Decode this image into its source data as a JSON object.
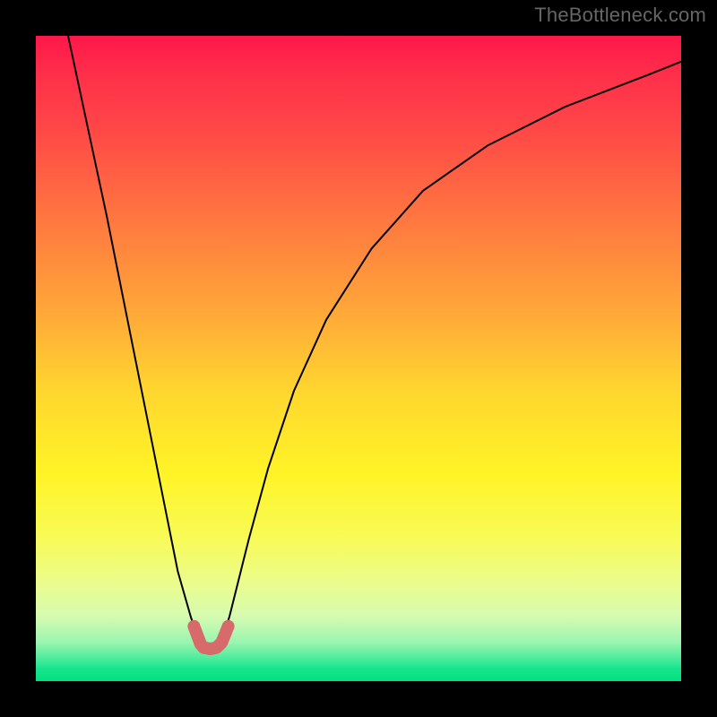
{
  "watermark": "TheBottleneck.com",
  "chart_data": {
    "type": "line",
    "title": "",
    "xlabel": "",
    "ylabel": "",
    "xlim": [
      0,
      100
    ],
    "ylim": [
      0,
      100
    ],
    "series": [
      {
        "name": "bottleneck-curve",
        "x": [
          5,
          8,
          11,
          14,
          17,
          20,
          22,
          24,
          25,
          26,
          27,
          28,
          29,
          30,
          31,
          33,
          36,
          40,
          45,
          52,
          60,
          70,
          82,
          95,
          100
        ],
        "values": [
          100,
          86,
          72,
          57,
          42,
          27,
          17,
          10,
          7,
          5.5,
          5,
          5.5,
          7,
          10,
          14,
          22,
          33,
          45,
          56,
          67,
          76,
          83,
          89,
          94,
          96
        ],
        "color": "#000000",
        "stroke_width": 2
      },
      {
        "name": "highlight-segment",
        "x": [
          24.5,
          25.5,
          26,
          27,
          28,
          28.8,
          29.8
        ],
        "values": [
          8.5,
          5.8,
          5.2,
          5.0,
          5.2,
          6.0,
          8.5
        ],
        "color": "#d76a6a",
        "stroke_width": 14
      }
    ],
    "background_gradient": {
      "direction": "top-to-bottom",
      "stops": [
        {
          "pos": 0,
          "color": "#ff174a"
        },
        {
          "pos": 0.14,
          "color": "#ff4647"
        },
        {
          "pos": 0.34,
          "color": "#ff8a3d"
        },
        {
          "pos": 0.55,
          "color": "#ffd62f"
        },
        {
          "pos": 0.78,
          "color": "#f8fb58"
        },
        {
          "pos": 0.9,
          "color": "#d6fbb0"
        },
        {
          "pos": 0.97,
          "color": "#2ae793"
        },
        {
          "pos": 1.0,
          "color": "#03df80"
        }
      ]
    }
  }
}
